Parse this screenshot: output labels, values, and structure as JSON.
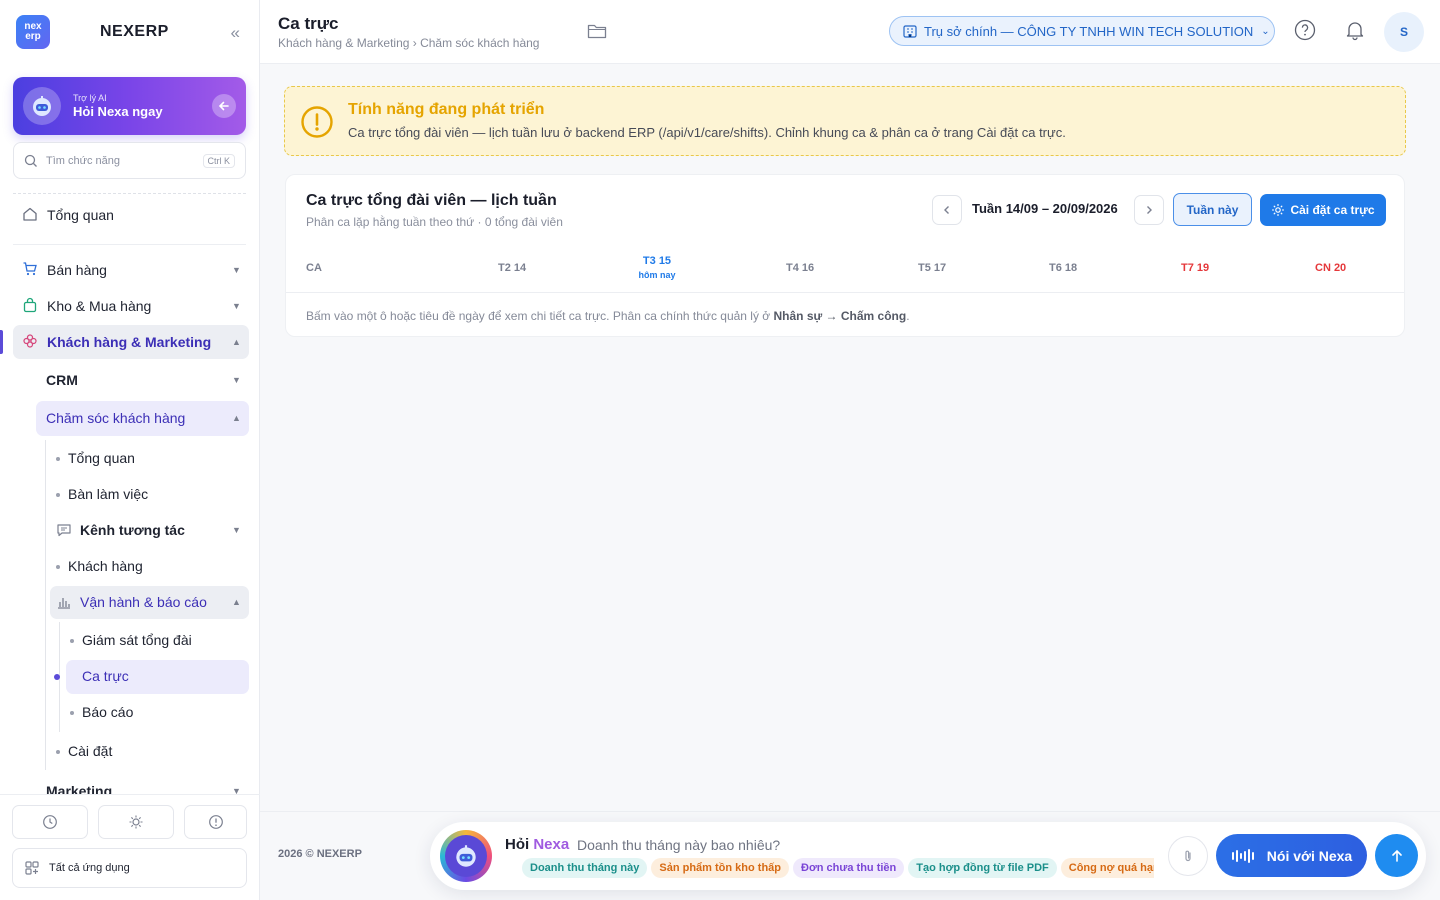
{
  "brand": {
    "logo_top": "nex",
    "logo_bottom": "erp",
    "name": "NEXERP"
  },
  "ai_card": {
    "small": "Trợ lý AI",
    "big": "Hỏi Nexa ngay"
  },
  "search": {
    "placeholder": "Tìm chức năng",
    "shortcut": "Ctrl K"
  },
  "sidebar": {
    "overview": "Tổng quan",
    "sales": "Bán hàng",
    "inventory": "Kho & Mua hàng",
    "customers_marketing": "Khách hàng & Marketing",
    "crm": "CRM",
    "customer_care": "Chăm sóc khách hàng",
    "care_overview": "Tổng quan",
    "workspace": "Bàn làm việc",
    "channels": "Kênh tương tác",
    "customers": "Khách hàng",
    "ops_reports": "Vận hành & báo cáo",
    "call_monitor": "Giám sát tổng đài",
    "shifts": "Ca trực",
    "reports": "Báo cáo",
    "settings": "Cài đặt",
    "marketing": "Marketing",
    "all_apps": "Tất cả ứng dụng"
  },
  "header": {
    "title": "Ca trực",
    "breadcrumb": "Khách hàng & Marketing › Chăm sóc khách hàng",
    "branch": "Trụ sở chính — CÔNG TY TNHH WIN TECH SOLUTION",
    "avatar_initial": "S"
  },
  "banner": {
    "title": "Tính năng đang phát triển",
    "desc": "Ca trực tổng đài viên — lịch tuần lưu ở backend ERP (/api/v1/care/shifts). Chỉnh khung ca & phân ca ở trang Cài đặt ca trực."
  },
  "card": {
    "title": "Ca trực tổng đài viên — lịch tuần",
    "subtitle": "Phân ca lặp hằng tuần theo thứ · 0 tổng đài viên",
    "week": "Tuần 14/09 – 20/09/2026",
    "this_week_btn": "Tuần này",
    "settings_btn": "Cài đặt ca trực",
    "columns": {
      "ca": "CA",
      "mon": "T2 14",
      "tue": "T3 15",
      "today": "hôm nay",
      "wed": "T4 16",
      "thu": "T5 17",
      "fri": "T6 18",
      "sat": "T7 19",
      "sun": "CN 20"
    },
    "hint_prefix": "Bấm vào một ô hoặc tiêu đề ngày để xem chi tiết ca trực. Phân ca chính thức quản lý ở ",
    "hint_bold": "Nhân sự → Chấm công",
    "hint_suffix": "."
  },
  "footer": {
    "copyright": "2026 © NEXERP",
    "ask_label": "Hỏi",
    "ask_nexa": "Nexa",
    "ask_question": "Doanh thu tháng này bao nhiêu?",
    "chips": [
      "Doanh thu tháng này",
      "Sản phẩm tồn kho thấp",
      "Đơn chưa thu tiền",
      "Tạo hợp đồng từ file PDF",
      "Công nợ quá hạn"
    ],
    "talk_btn": "Nói với Nexa"
  },
  "colors": {
    "accent": "#1f7ae8",
    "purple": "#5b4bd8",
    "warning": "#e5a400",
    "weekend": "#e5383b"
  }
}
